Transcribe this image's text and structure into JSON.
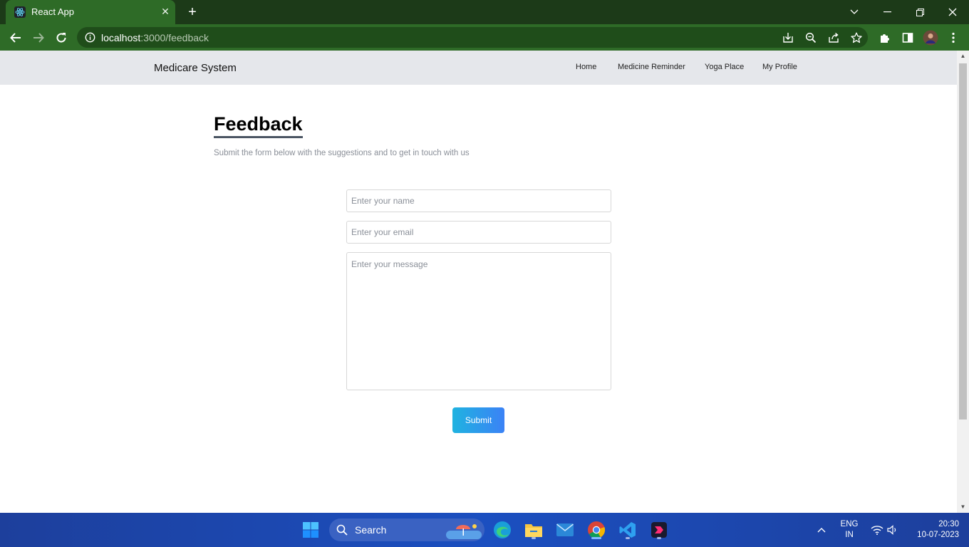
{
  "browser": {
    "tab_title": "React App",
    "url_host": "localhost",
    "url_path": ":3000/feedback"
  },
  "navbar": {
    "brand": "Medicare System",
    "links": [
      "Home",
      "Medicine Reminder",
      "Yoga Place",
      "My Profile"
    ]
  },
  "page": {
    "title": "Feedback",
    "subtitle": "Submit the form below with the suggestions and to get in touch with us"
  },
  "form": {
    "name_placeholder": "Enter your name",
    "name_value": "",
    "email_placeholder": "Enter your email",
    "email_value": "",
    "message_placeholder": "Enter your message",
    "message_value": "",
    "submit_label": "Submit"
  },
  "taskbar": {
    "search_label": "Search",
    "lang_line1": "ENG",
    "lang_line2": "IN",
    "time": "20:30",
    "date": "10-07-2023"
  },
  "colors": {
    "browser_frame": "#2e6b27",
    "navbar_bg": "#e5e7eb",
    "submit_gradient_start": "#1fb3e0",
    "submit_gradient_end": "#3b82f6",
    "taskbar_bg": "#1b4fc0"
  }
}
